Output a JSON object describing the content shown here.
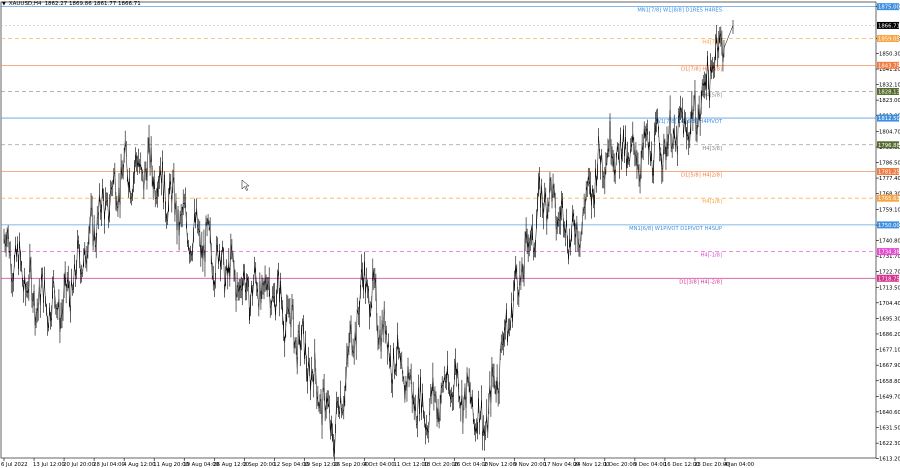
{
  "header": {
    "symbol": "XAUUSD,H4",
    "ohlc": "1862.27 1869.86 1861.77 1866.71"
  },
  "chart_data": {
    "type": "candlestick",
    "title": "XAUUSD,H4",
    "ohlc_last": {
      "open": 1862.27,
      "high": 1869.86,
      "low": 1861.77,
      "close": 1866.71
    },
    "current_price": 1866.71,
    "ylim": [
      1613.6,
      1877.5
    ],
    "y_ticks": [
      1877.7,
      1859.05,
      1850.3,
      1841.2,
      1832.1,
      1823.0,
      1813.9,
      1804.7,
      1795.6,
      1786.5,
      1777.4,
      1768.3,
      1759.1,
      1749.9,
      1740.8,
      1731.7,
      1722.7,
      1713.5,
      1704.4,
      1695.3,
      1686.2,
      1677.1,
      1667.9,
      1658.8,
      1649.7,
      1640.6,
      1631.5,
      1622.3,
      1613.2
    ],
    "x_ticks": [
      "6 Jul 2022",
      "13 Jul 12:00",
      "20 Jul 20:00",
      "28 Jul 04:00",
      "4 Aug 12:00",
      "11 Aug 20:00",
      "19 Aug 04:00",
      "26 Aug 12:00",
      "2 Sep 20:00",
      "12 Sep 04:00",
      "19 Sep 12:00",
      "26 Sep 20:00",
      "4 Oct 04:00",
      "11 Oct 12:00",
      "18 Oct 20:00",
      "26 Oct 04:00",
      "2 Nov 12:00",
      "9 Nov 20:00",
      "17 Nov 04:00",
      "24 Nov 12:00",
      "1 Dec 20:00",
      "9 Dec 04:00",
      "16 Dec 12:00",
      "23 Dec 20:00",
      "4 Jan 04:00"
    ],
    "price_series": [
      [
        "6 Jul 2022",
        1742
      ],
      [
        "13 Jul 12:00",
        1708
      ],
      [
        "20 Jul 20:00",
        1703
      ],
      [
        "28 Jul 04:00",
        1750
      ],
      [
        "4 Aug 12:00",
        1781
      ],
      [
        "11 Aug 20:00",
        1783
      ],
      [
        "19 Aug 04:00",
        1750
      ],
      [
        "26 Aug 12:00",
        1733
      ],
      [
        "2 Sep 20:00",
        1713
      ],
      [
        "12 Sep 04:00",
        1712
      ],
      [
        "19 Sep 12:00",
        1675
      ],
      [
        "26 Sep 20:00",
        1628
      ],
      [
        "4 Oct 04:00",
        1720
      ],
      [
        "11 Oct 12:00",
        1670
      ],
      [
        "18 Oct 20:00",
        1640
      ],
      [
        "26 Oct 04:00",
        1660
      ],
      [
        "2 Nov 12:00",
        1632
      ],
      [
        "9 Nov 20:00",
        1710
      ],
      [
        "17 Nov 04:00",
        1770
      ],
      [
        "24 Nov 12:00",
        1742
      ],
      [
        "1 Dec 20:00",
        1795
      ],
      [
        "9 Dec 04:00",
        1790
      ],
      [
        "16 Dec 12:00",
        1798
      ],
      [
        "23 Dec 20:00",
        1812
      ],
      [
        "4 Jan 04:00",
        1866.71
      ]
    ],
    "levels": [
      {
        "price": 1877.7,
        "label": "MN1[7/8] W1[8/8] D1RES H4RES",
        "color": "#3d8fe0",
        "dashed": false
      },
      {
        "price": 1859.05,
        "label": "H4[7/8]",
        "color": "#f7a541",
        "dashed": true
      },
      {
        "price": 1843.35,
        "label": "D1[7/8] H4[6/8]",
        "color": "#f27b41",
        "dashed": false
      },
      {
        "price": 1828.07,
        "label": "H4[5/8]",
        "color": "#8a8a8a",
        "dashed": true
      },
      {
        "price": 1812.5,
        "label": "W1[7/8] D1[6/8] H4PIVOT",
        "color": "#3d8fe0",
        "dashed": false
      },
      {
        "price": 1796.88,
        "label": "H4[3/8]",
        "color": "#8a8a8a",
        "dashed": true
      },
      {
        "price": 1781.25,
        "label": "D1[5/8] H4[2/8]",
        "color": "#f27b41",
        "dashed": false
      },
      {
        "price": 1765.62,
        "label": "H4[1/8]",
        "color": "#f7a541",
        "dashed": true
      },
      {
        "price": 1750.0,
        "label": "MN1[6/8] W1PIVOT D1PIVOT H4SUP",
        "color": "#3d8fe0",
        "dashed": false
      },
      {
        "price": 1734.38,
        "label": "H4[-1/8]",
        "color": "#e64ad0",
        "dashed": true
      },
      {
        "price": 1718.75,
        "label": "D1[3/8] H4[-2/8]",
        "color": "#d4358f",
        "dashed": false
      }
    ],
    "price_tags": [
      {
        "text": "1875.00",
        "price": 1877.7,
        "bg": "#3d8fe0"
      },
      {
        "text": "1866.71",
        "price": 1866.71,
        "bg": "#000000"
      },
      {
        "text": "1859.05",
        "price": 1859.05,
        "bg": "#f7a541"
      },
      {
        "text": "1843.75",
        "price": 1843.35,
        "bg": "#f27b41"
      },
      {
        "text": "1828.13",
        "price": 1828.07,
        "bg": "#556b2f"
      },
      {
        "text": "1812.50",
        "price": 1812.5,
        "bg": "#3d8fe0"
      },
      {
        "text": "1796.88",
        "price": 1796.88,
        "bg": "#556b2f"
      },
      {
        "text": "1781.25",
        "price": 1781.25,
        "bg": "#f27b41"
      },
      {
        "text": "1765.63",
        "price": 1765.62,
        "bg": "#f7a541"
      },
      {
        "text": "1750.00",
        "price": 1750.0,
        "bg": "#3d8fe0"
      },
      {
        "text": "1734.38",
        "price": 1734.38,
        "bg": "#e64ad0"
      },
      {
        "text": "1718.75",
        "price": 1718.75,
        "bg": "#d4358f"
      }
    ],
    "grid": false,
    "legend": "none"
  }
}
